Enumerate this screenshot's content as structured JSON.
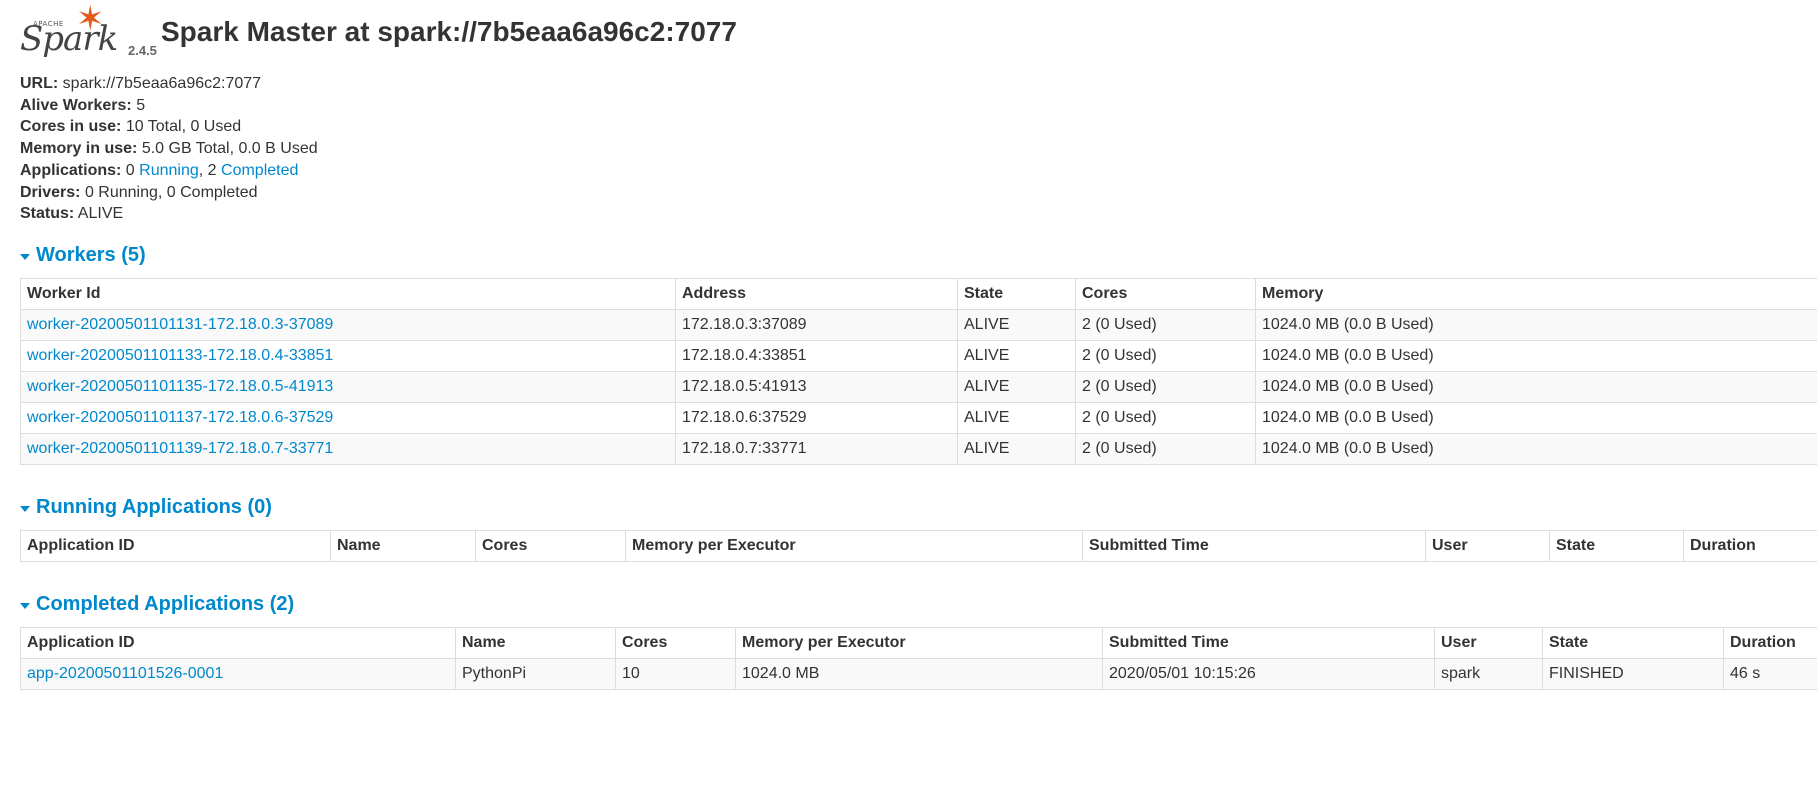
{
  "header": {
    "logo_apache": "APACHE",
    "logo_text": "Spark",
    "version": "2.4.5",
    "title": "Spark Master at spark://7b5eaa6a96c2:7077"
  },
  "summary": {
    "url_label": "URL:",
    "url_value": "spark://7b5eaa6a96c2:7077",
    "alive_workers_label": "Alive Workers:",
    "alive_workers_value": "5",
    "cores_label": "Cores in use:",
    "cores_value": "10 Total, 0 Used",
    "memory_label": "Memory in use:",
    "memory_value": "5.0 GB Total, 0.0 B Used",
    "applications_label": "Applications:",
    "applications_running_count": "0",
    "applications_running_link": "Running",
    "applications_sep": ", 2",
    "applications_completed_link": "Completed",
    "drivers_label": "Drivers:",
    "drivers_value": "0 Running, 0 Completed",
    "status_label": "Status:",
    "status_value": "ALIVE"
  },
  "workers": {
    "heading": "Workers (5)",
    "columns": [
      "Worker Id",
      "Address",
      "State",
      "Cores",
      "Memory"
    ],
    "rows": [
      {
        "id": "worker-20200501101131-172.18.0.3-37089",
        "address": "172.18.0.3:37089",
        "state": "ALIVE",
        "cores": "2 (0 Used)",
        "memory": "1024.0 MB (0.0 B Used)"
      },
      {
        "id": "worker-20200501101133-172.18.0.4-33851",
        "address": "172.18.0.4:33851",
        "state": "ALIVE",
        "cores": "2 (0 Used)",
        "memory": "1024.0 MB (0.0 B Used)"
      },
      {
        "id": "worker-20200501101135-172.18.0.5-41913",
        "address": "172.18.0.5:41913",
        "state": "ALIVE",
        "cores": "2 (0 Used)",
        "memory": "1024.0 MB (0.0 B Used)"
      },
      {
        "id": "worker-20200501101137-172.18.0.6-37529",
        "address": "172.18.0.6:37529",
        "state": "ALIVE",
        "cores": "2 (0 Used)",
        "memory": "1024.0 MB (0.0 B Used)"
      },
      {
        "id": "worker-20200501101139-172.18.0.7-33771",
        "address": "172.18.0.7:33771",
        "state": "ALIVE",
        "cores": "2 (0 Used)",
        "memory": "1024.0 MB (0.0 B Used)"
      }
    ]
  },
  "running_apps": {
    "heading": "Running Applications (0)",
    "columns": [
      "Application ID",
      "Name",
      "Cores",
      "Memory per Executor",
      "Submitted Time",
      "User",
      "State",
      "Duration"
    ]
  },
  "completed_apps": {
    "heading": "Completed Applications (2)",
    "columns": [
      "Application ID",
      "Name",
      "Cores",
      "Memory per Executor",
      "Submitted Time",
      "User",
      "State",
      "Duration"
    ],
    "rows": [
      {
        "id": "app-20200501101526-0001",
        "name": "PythonPi",
        "cores": "10",
        "memory": "1024.0 MB",
        "submitted": "2020/05/01 10:15:26",
        "user": "spark",
        "state": "FINISHED",
        "duration": "46 s"
      }
    ]
  },
  "colors": {
    "link": "#0088cc",
    "logo_star": "#e25a1c",
    "row_stripe": "#f9f9f9",
    "border": "#dddddd"
  }
}
